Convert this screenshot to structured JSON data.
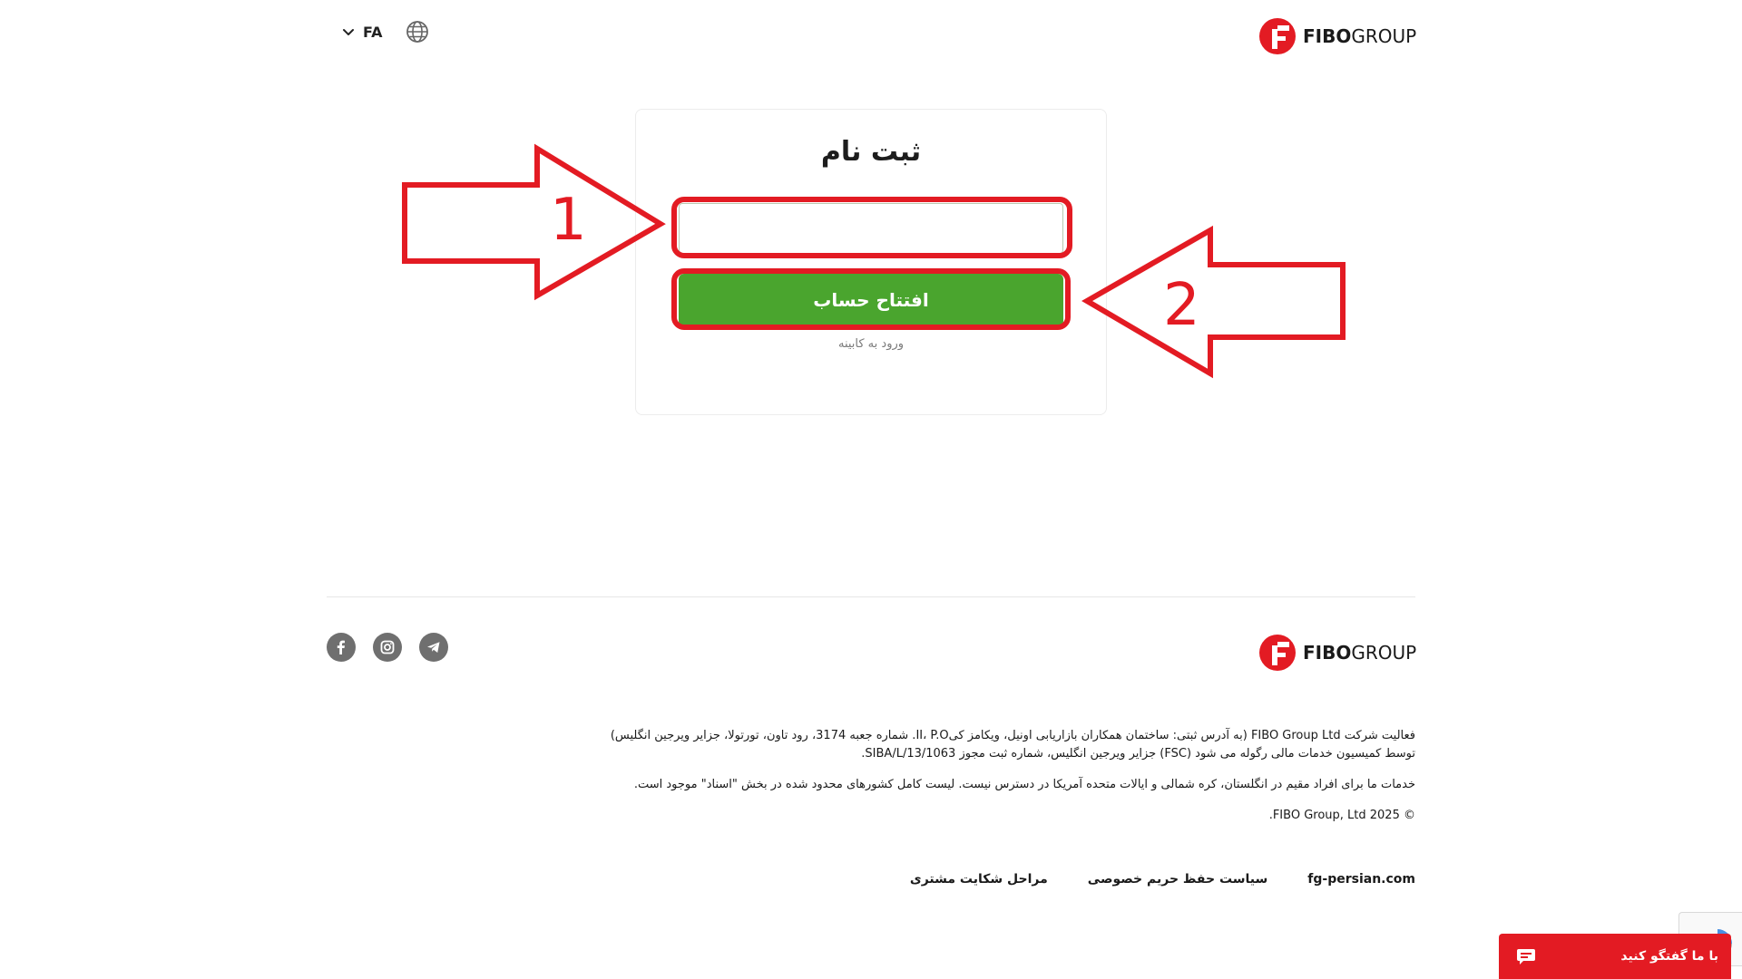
{
  "header": {
    "language_code": "FA",
    "logo_bold": "FIBO",
    "logo_light": "GROUP"
  },
  "form": {
    "title": "ثبت نام",
    "name_input_value": "",
    "name_input_placeholder": "",
    "submit_label": "افتتاح حساب",
    "cabinet_link_label": "ورود به کابینه"
  },
  "annotations": {
    "label_1": "1",
    "label_2": "2"
  },
  "footer": {
    "logo_bold": "FIBO",
    "logo_light": "GROUP",
    "socials": [
      "facebook-icon",
      "instagram-icon",
      "telegram-icon"
    ],
    "legal_line_1": "فعالیت شرکت FIBO Group Ltd (به آدرس ثبتی: ساختمان همکاران بازاریابی اونیل، ویکامز کیII، P.O. شماره جعبه 3174، رود تاون، تورتولا، جزایر ویرجین انگلیس)",
    "legal_line_2": "توسط کمیسیون خدمات مالی رگوله می شود (FSC) جزایر ویرجین انگلیس، شماره ثبت مجوز SIBA/L/13/1063.",
    "legal_services": "خدمات ما برای افراد مقیم در انگلستان، کره شمالی و ایالات متحده آمریکا در دسترس نیست. لیست کامل کشورهای محدود شده در بخش \"اسناد\" موجود است.",
    "copyright": "© FIBO Group, Ltd 2025.",
    "links": [
      {
        "label": "مراحل شکایت مشتری"
      },
      {
        "label": "سیاست حفظ حریم خصوصی"
      },
      {
        "label": "fg-persian.com"
      }
    ]
  },
  "chat": {
    "label": "با ما گفتگو کنید"
  },
  "colors": {
    "brand_red": "#e31b23",
    "button_green": "#4aa52e"
  }
}
